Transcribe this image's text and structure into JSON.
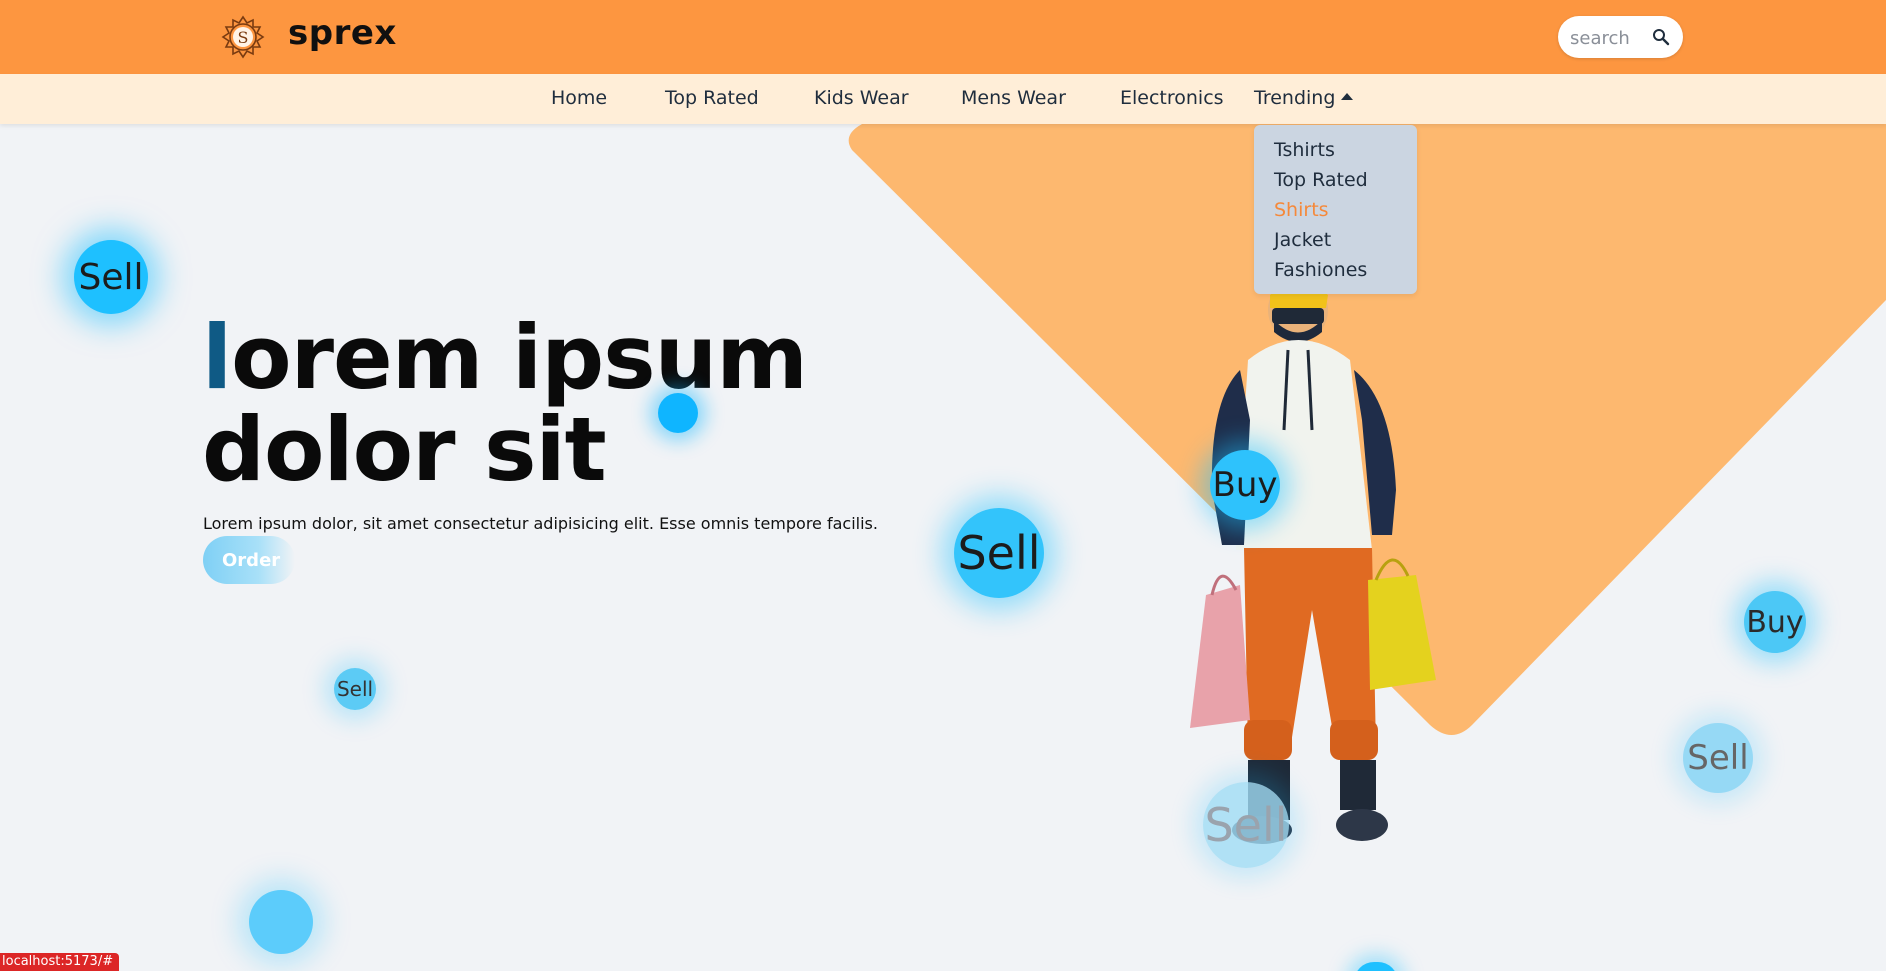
{
  "brand": {
    "name": "sprex",
    "logo_letter": "S"
  },
  "search": {
    "placeholder": "search"
  },
  "nav": {
    "items": [
      "Home",
      "Top Rated",
      "Kids Wear",
      "Mens Wear",
      "Electronics"
    ],
    "trending": "Trending"
  },
  "dropdown": {
    "items": [
      "Tshirts",
      "Top Rated",
      "Shirts",
      "Jacket",
      "Fashiones"
    ],
    "active_index": 2
  },
  "hero": {
    "title_first_letter": "l",
    "title_line1_rest": "orem ipsum",
    "title_line2": "dolor sit",
    "subtitle": "Lorem ipsum dolor, sit amet consectetur adipisicing elit. Esse omnis tempore facilis.",
    "order_label": "Order"
  },
  "bubbles": {
    "sell_1": "Sell",
    "sell_2": "Sell",
    "sell_3": "Sell",
    "sell_4": "Sell",
    "sell_5": "Sell",
    "buy_1": "Buy",
    "buy_2": "Buy"
  },
  "status_bar": {
    "url": "localhost:5173/#"
  },
  "colors": {
    "header": "#fd9640",
    "navbar": "#ffeed8",
    "diamond": "#fdb86f",
    "accent_blue": "#0f5a85",
    "bubble": "#1ec0ff",
    "active_dropdown": "#f5893a"
  }
}
